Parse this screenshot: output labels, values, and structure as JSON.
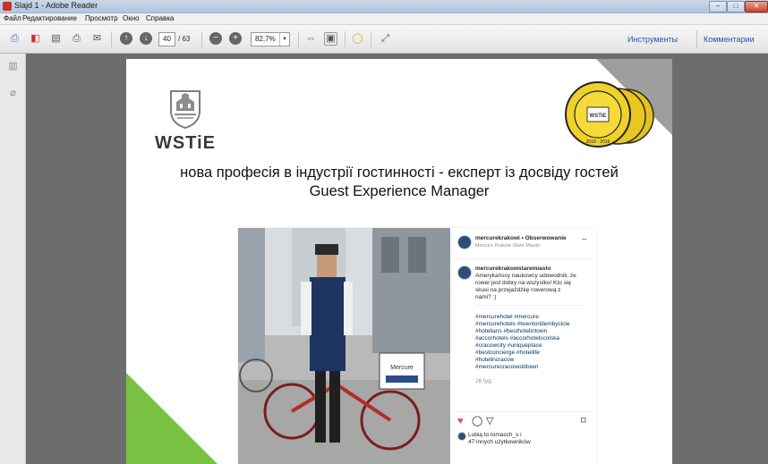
{
  "window": {
    "title": "Slajd 1 - Adobe Reader",
    "minimize": "–",
    "maximize": "□",
    "close": "✕"
  },
  "menu": [
    "Файл",
    "Редактирование",
    "Просмотр",
    "Окно",
    "Справка"
  ],
  "toolbar": {
    "page_current": "40",
    "page_total": "/ 63",
    "zoom": "82,7%",
    "tools_link": "Инструменты",
    "comments_link": "Комментарии"
  },
  "slide": {
    "logo_text": "WSTiE",
    "badge_text": "LIDER EDUKACJI TURYSTYCZNEJ W POLSCE",
    "badge_center": "WSTiE",
    "badge_years": "2018 · 2019",
    "headline_line1": "нова професія в індустрії гостинності - експерт із досвіду гостей",
    "headline_line2": "Guest Experience Manager"
  },
  "instagram": {
    "account": "mercurekrakowi • Obserwowanie",
    "location": "Mercure Kraków Stare Miasto",
    "more": "...",
    "commenter": "mercurekrakowstaremiasto",
    "comment_lines": [
      "Amerykańscy naukowcy udowodnili, że",
      "rower jest dobry na wszystko! Kto się",
      "skusi na przejażdżkę rowerową z",
      "nami? :)"
    ],
    "hashtags": [
      "#mercurehotel #mercure",
      "#mercurehotels #twentorldembycicle",
      "#hotelians #besthotelintown",
      "#accorhotels #accorhotelscolska",
      "#cracowcity #uniqueplace",
      "#bestconcierge #hotellife",
      "#hotelincracow",
      "#mercurecracowoldtown"
    ],
    "age": "26 tyg.",
    "likes_line1": "Lubią to tomasch_s i",
    "likes_line2": "47 innych użytkowników",
    "sign_text": "Mercure"
  },
  "colors": {
    "accent_green": "#7ac143",
    "corner_gray": "#9e9e9e",
    "badge_gold": "#e2c21d",
    "link_blue": "#1e5aa8"
  }
}
